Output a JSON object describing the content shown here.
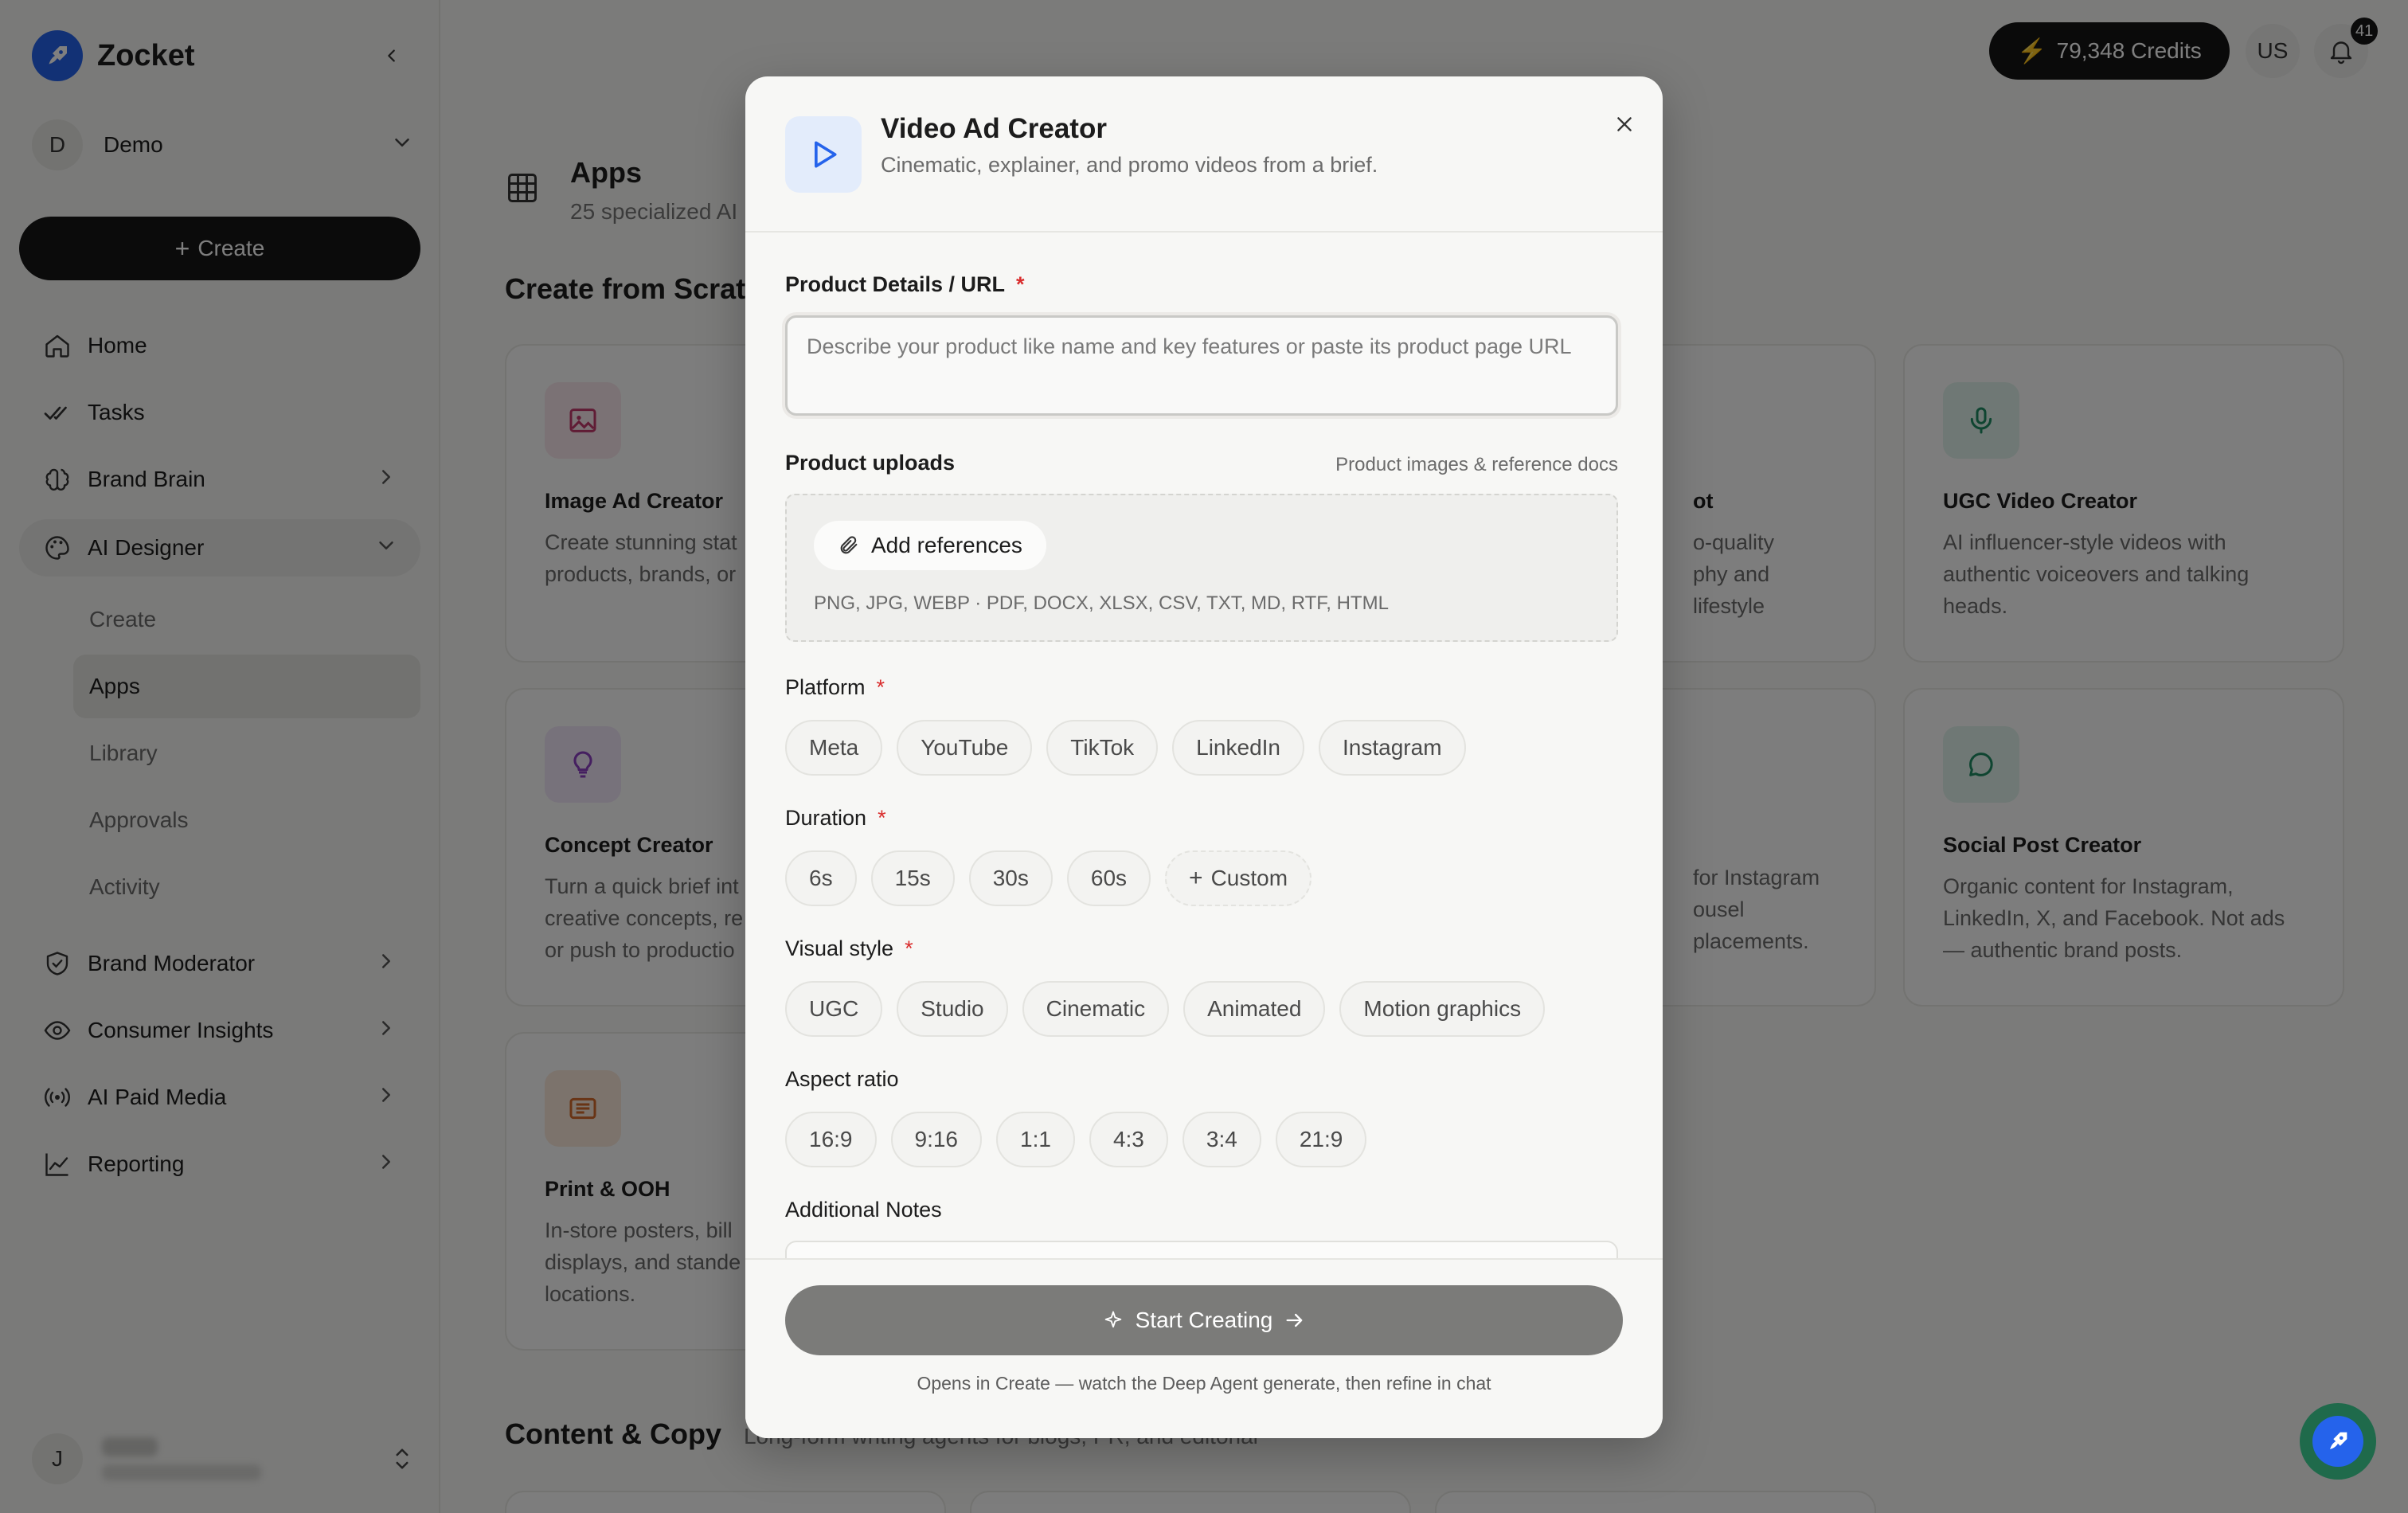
{
  "sidebar": {
    "brand": "Zocket",
    "workspace": {
      "initial": "D",
      "name": "Demo"
    },
    "create_label": "Create",
    "nav": [
      {
        "label": "Home"
      },
      {
        "label": "Tasks"
      },
      {
        "label": "Brand Brain"
      },
      {
        "label": "AI Designer"
      },
      {
        "label": "Brand Moderator"
      },
      {
        "label": "Consumer Insights"
      },
      {
        "label": "AI Paid Media"
      },
      {
        "label": "Reporting"
      }
    ],
    "ai_designer_sub": [
      {
        "label": "Create"
      },
      {
        "label": "Apps"
      },
      {
        "label": "Library"
      },
      {
        "label": "Approvals"
      },
      {
        "label": "Activity"
      }
    ],
    "user": {
      "initial": "J"
    }
  },
  "topbar": {
    "credits": "79,348 Credits",
    "locale": "US",
    "notifications": "41"
  },
  "page": {
    "title": "Apps",
    "subtitle": "25 specialized AI",
    "section_create": "Create from Scrat",
    "section_content": "Content & Copy",
    "section_content_sub": "Long-form writing agents for blogs, PR, and editorial"
  },
  "cards": {
    "image_ad": {
      "title": "Image Ad Creator",
      "desc1": "Create stunning stat",
      "desc2": "products, brands, or"
    },
    "concept": {
      "title": "Concept Creator",
      "desc1": "Turn a quick brief int",
      "desc2": "creative concepts, re",
      "desc3": "or push to productio"
    },
    "print": {
      "title": "Print & OOH",
      "desc1": "In-store posters, bill",
      "desc2": "displays, and stande",
      "desc3": "locations."
    },
    "photo": {
      "title": "ot",
      "desc1": "o-quality",
      "desc2": "phy and lifestyle"
    },
    "carousel": {
      "desc1": "for Instagram",
      "desc2": "ousel placements."
    },
    "ugc": {
      "title": "UGC Video Creator",
      "desc1": "AI influencer-style videos with",
      "desc2": "authentic voiceovers and talking",
      "desc3": "heads."
    },
    "social": {
      "title": "Social Post Creator",
      "desc1": "Organic content for Instagram,",
      "desc2": "LinkedIn, X, and Facebook. Not ads",
      "desc3": "— authentic brand posts."
    }
  },
  "modal": {
    "title": "Video Ad Creator",
    "subtitle": "Cinematic, explainer, and promo videos from a brief.",
    "product_label": "Product Details / URL",
    "product_placeholder": "Describe your product like name and key features or paste its product page URL",
    "uploads_label": "Product uploads",
    "uploads_hint": "Product images & reference docs",
    "add_references": "Add references",
    "formats": "PNG, JPG, WEBP · PDF, DOCX, XLSX, CSV, TXT, MD, RTF, HTML",
    "platform_label": "Platform",
    "platforms": [
      "Meta",
      "YouTube",
      "TikTok",
      "LinkedIn",
      "Instagram"
    ],
    "duration_label": "Duration",
    "durations": [
      "6s",
      "15s",
      "30s",
      "60s"
    ],
    "custom_label": "Custom",
    "visual_label": "Visual style",
    "visual_styles": [
      "UGC",
      "Studio",
      "Cinematic",
      "Animated",
      "Motion graphics"
    ],
    "aspect_label": "Aspect ratio",
    "aspect_ratios": [
      "16:9",
      "9:16",
      "1:1",
      "4:3",
      "3:4",
      "21:9"
    ],
    "notes_label": "Additional Notes",
    "required_mark": "*",
    "start_label": "Start Creating",
    "footer_note": "Opens in Create — watch the Deep Agent generate, then refine in chat"
  }
}
